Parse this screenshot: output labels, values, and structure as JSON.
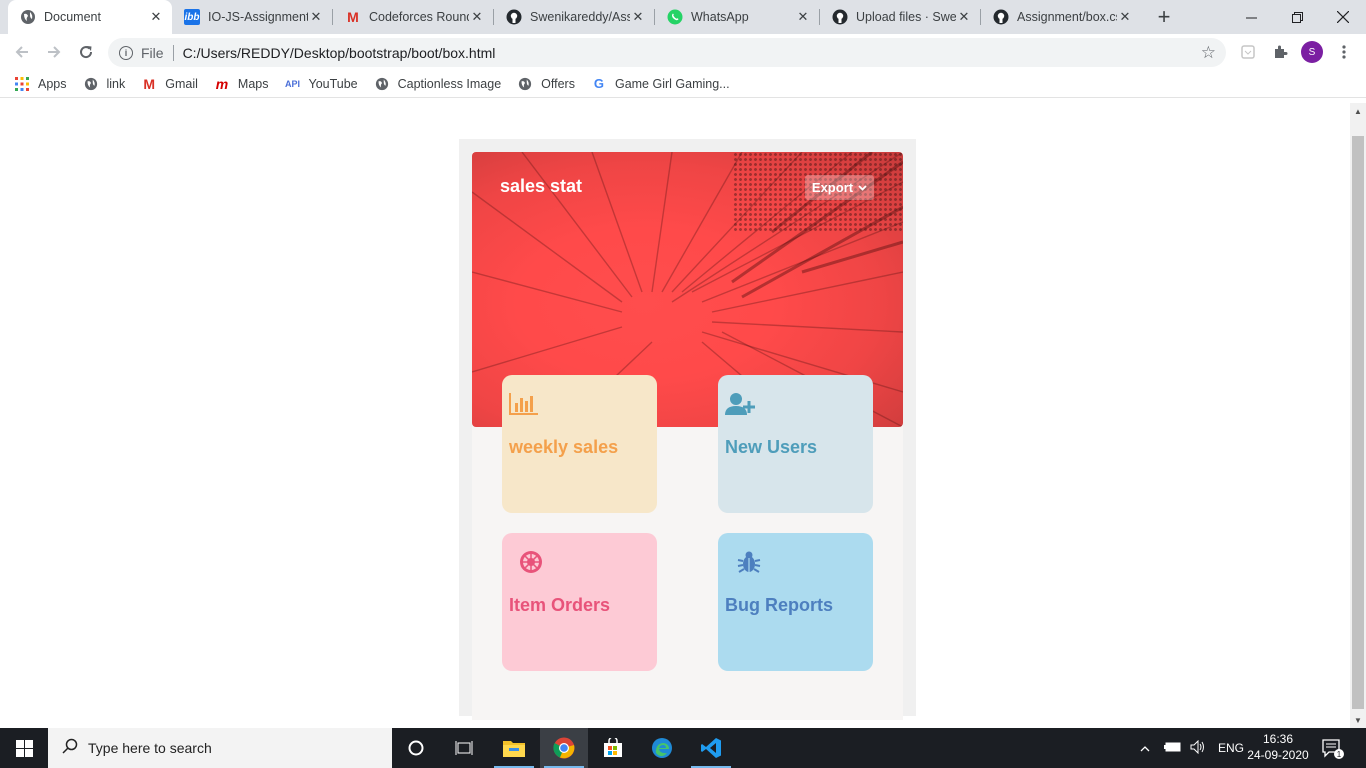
{
  "browser": {
    "tabs": [
      {
        "title": "Document",
        "active": true
      },
      {
        "title": "IO-JS-Assignment",
        "active": false
      },
      {
        "title": "Codeforces Round",
        "active": false
      },
      {
        "title": "Swenikareddy/Ass",
        "active": false
      },
      {
        "title": "WhatsApp",
        "active": false
      },
      {
        "title": "Upload files · Swen",
        "active": false
      },
      {
        "title": "Assignment/box.cs",
        "active": false
      }
    ],
    "address": {
      "scheme": "File",
      "url": "C:/Users/REDDY/Desktop/bootstrap/boot/box.html"
    },
    "profile_initial": "S",
    "bookmarks": [
      "Apps",
      "link",
      "Gmail",
      "Maps",
      "YouTube",
      "Captionless Image",
      "Offers",
      "Game Girl Gaming..."
    ]
  },
  "page": {
    "hero_title": "sales stat",
    "export_label": "Export",
    "tiles": [
      {
        "label": "weekly sales",
        "icon": "bar-chart-icon"
      },
      {
        "label": "New Users",
        "icon": "user-plus-icon"
      },
      {
        "label": "Item Orders",
        "icon": "empire-icon"
      },
      {
        "label": "Bug Reports",
        "icon": "bug-icon"
      }
    ],
    "colors": {
      "hero": "#ff4a4a",
      "weekly": "#f4a04b",
      "users": "#4e9dba",
      "orders": "#e8537a",
      "bugs": "#4d7fbf"
    }
  },
  "taskbar": {
    "search_placeholder": "Type here to search",
    "language": "ENG",
    "time": "16:36",
    "date": "24-09-2020",
    "notification_count": "1"
  }
}
